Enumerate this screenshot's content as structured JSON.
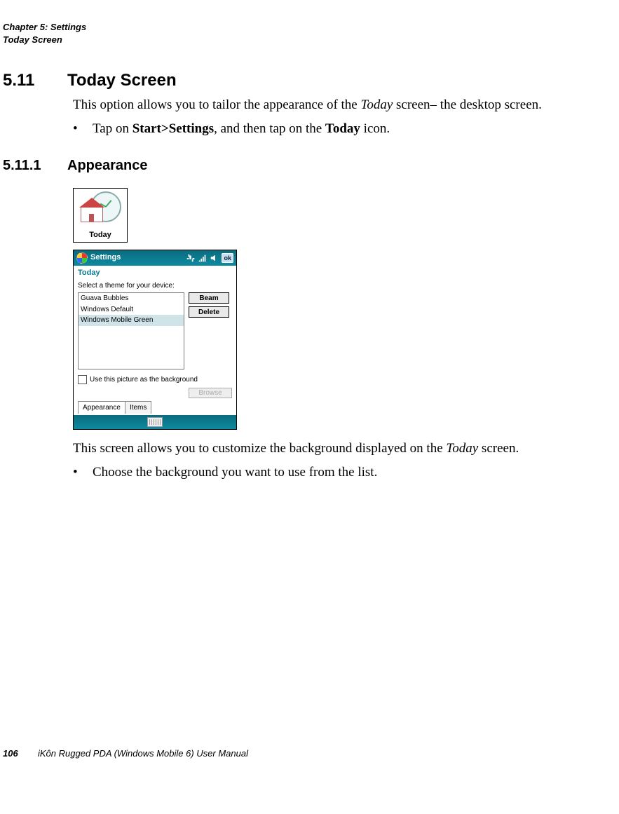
{
  "header": {
    "chapter_line": "Chapter 5: Settings",
    "section_line": "Today Screen"
  },
  "h511": {
    "num": "5.11",
    "title": "Today Screen",
    "intro_pre": "This option allows you to tailor the appearance of the ",
    "intro_em": "Today",
    "intro_post": " screen– the desktop screen.",
    "bullet_pre": "Tap on ",
    "bullet_b1": "Start>Settings",
    "bullet_mid": ", and then tap on the ",
    "bullet_b2": "Today",
    "bullet_post": " icon."
  },
  "h5111": {
    "num": "5.11.1",
    "title": "Appearance"
  },
  "today_icon_label": "Today",
  "device": {
    "titlebar_text": "Settings",
    "ok_label": "ok",
    "subtitle": "Today",
    "instruction": "Select a theme for your device:",
    "themes": [
      "Guava Bubbles",
      "Windows Default",
      "Windows Mobile Green"
    ],
    "selected_theme_index": 2,
    "beam_btn": "Beam",
    "delete_btn": "Delete",
    "checkbox_label": "Use this picture as the background",
    "browse_btn": "Browse",
    "tab_appearance": "Appearance",
    "tab_items": "Items"
  },
  "after": {
    "line_pre": "This screen allows you to customize the background displayed on the ",
    "line_em": "Today",
    "line_post": " screen.",
    "bullet": "Choose the background you want to use from the list."
  },
  "footer": {
    "page": "106",
    "title": "iKôn Rugged PDA (Windows Mobile 6) User Manual"
  }
}
